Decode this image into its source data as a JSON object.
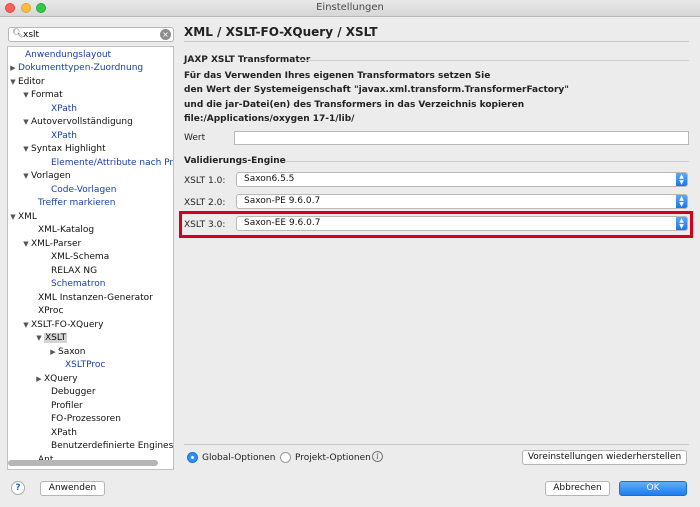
{
  "window": {
    "title": "Einstellungen"
  },
  "search": {
    "value": "xslt"
  },
  "tree": {
    "items": [
      {
        "label": "Anwendungslayout",
        "toggle": "",
        "link": true
      },
      {
        "label": "Dokumenttypen-Zuordnung",
        "toggle": "▶",
        "link": true
      },
      {
        "label": "Editor",
        "toggle": "▼",
        "link": false
      },
      {
        "label": "Format",
        "toggle": "▼",
        "link": false
      },
      {
        "label": "XPath",
        "toggle": "",
        "link": true
      },
      {
        "label": "Autovervollständigung",
        "toggle": "▼",
        "link": false
      },
      {
        "label": "XPath",
        "toggle": "",
        "link": true
      },
      {
        "label": "Syntax Highlight",
        "toggle": "▼",
        "link": false
      },
      {
        "label": "Elemente/Attribute nach Präfi",
        "toggle": "",
        "link": true
      },
      {
        "label": "Vorlagen",
        "toggle": "▼",
        "link": false
      },
      {
        "label": "Code-Vorlagen",
        "toggle": "",
        "link": true
      },
      {
        "label": "Treffer markieren",
        "toggle": "",
        "link": true
      },
      {
        "label": "XML",
        "toggle": "▼",
        "link": false
      },
      {
        "label": "XML-Katalog",
        "toggle": "",
        "link": false
      },
      {
        "label": "XML-Parser",
        "toggle": "▼",
        "link": false
      },
      {
        "label": "XML-Schema",
        "toggle": "",
        "link": false
      },
      {
        "label": "RELAX NG",
        "toggle": "",
        "link": false
      },
      {
        "label": "Schematron",
        "toggle": "",
        "link": true
      },
      {
        "label": "XML Instanzen-Generator",
        "toggle": "",
        "link": false
      },
      {
        "label": "XProc",
        "toggle": "",
        "link": false
      },
      {
        "label": "XSLT-FO-XQuery",
        "toggle": "▼",
        "link": false
      },
      {
        "label": "XSLT",
        "toggle": "▼",
        "link": false,
        "selected": true
      },
      {
        "label": "Saxon",
        "toggle": "▶",
        "link": false
      },
      {
        "label": "XSLTProc",
        "toggle": "",
        "link": true
      },
      {
        "label": "XQuery",
        "toggle": "▶",
        "link": false
      },
      {
        "label": "Debugger",
        "toggle": "",
        "link": false
      },
      {
        "label": "Profiler",
        "toggle": "",
        "link": false
      },
      {
        "label": "FO-Prozessoren",
        "toggle": "",
        "link": false
      },
      {
        "label": "XPath",
        "toggle": "",
        "link": false
      },
      {
        "label": "Benutzerdefinierte Engines",
        "toggle": "",
        "link": false
      },
      {
        "label": "Ant",
        "toggle": "",
        "link": false
      }
    ]
  },
  "main": {
    "breadcrumb": "XML / XSLT-FO-XQuery / XSLT",
    "jaxp": {
      "title": "JAXP XSLT Transformator",
      "description": [
        "Für das Verwenden Ihres eigenen Transformators setzen Sie",
        "den Wert der Systemeigenschaft \"javax.xml.transform.TransformerFactory\"",
        "und die jar-Datei(en) des Transformers in das Verzeichnis kopieren",
        "file:/Applications/oxygen 17-1/lib/"
      ],
      "value_label": "Wert",
      "value": ""
    },
    "validation": {
      "title": "Validierungs-Engine",
      "xslt1_label": "XSLT 1.0:",
      "xslt1_value": "Saxon6.5.5",
      "xslt2_label": "XSLT 2.0:",
      "xslt2_value": "Saxon-PE 9.6.0.7",
      "xslt3_label": "XSLT 3.0:",
      "xslt3_value": "Saxon-EE 9.6.0.7"
    },
    "options": {
      "global": "Global-Optionen",
      "project": "Projekt-Optionen",
      "restore": "Voreinstellungen wiederherstellen"
    }
  },
  "footer": {
    "apply": "Anwenden",
    "cancel": "Abbrechen",
    "ok": "OK"
  },
  "colors": {
    "accent": "#1c7df0",
    "highlight": "#d0021b",
    "link": "#1a3fa3"
  }
}
